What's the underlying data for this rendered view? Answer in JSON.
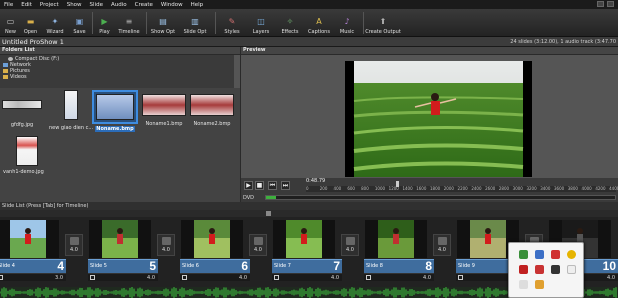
{
  "menu": [
    "File",
    "Edit",
    "Project",
    "Show",
    "Slide",
    "Audio",
    "Create",
    "Window",
    "Help"
  ],
  "toolbar": [
    {
      "label": "New",
      "icon": "new-icon",
      "color": "#c8c8c8"
    },
    {
      "label": "Open",
      "icon": "open-folder-icon",
      "color": "#d9b04a"
    },
    {
      "label": "Wizard",
      "icon": "wizard-icon",
      "color": "#8fb4e0"
    },
    {
      "label": "Save",
      "icon": "save-icon",
      "color": "#7aa0d0"
    },
    {
      "label": "Play",
      "icon": "play-icon",
      "color": "#4caf50"
    },
    {
      "label": "Timeline",
      "icon": "timeline-icon",
      "color": "#b0b0b0"
    },
    {
      "label": "Show Opt",
      "icon": "show-options-icon",
      "color": "#9cc3e8"
    },
    {
      "label": "Slide Opt",
      "icon": "slide-options-icon",
      "color": "#9cc3e8"
    },
    {
      "label": "Styles",
      "icon": "styles-icon",
      "color": "#d07070"
    },
    {
      "label": "Layers",
      "icon": "layers-icon",
      "color": "#7ab0e0"
    },
    {
      "label": "Effects",
      "icon": "effects-icon",
      "color": "#70b070"
    },
    {
      "label": "Captions",
      "icon": "captions-icon",
      "color": "#e0c050"
    },
    {
      "label": "Music",
      "icon": "music-icon",
      "color": "#b080d0"
    },
    {
      "label": "Create Output",
      "icon": "create-output-icon",
      "color": "#b0b0b0"
    }
  ],
  "project": {
    "title": "Untitled ProShow 1",
    "stats": "24 slides (3:12.00), 1 audio track (3:47.70"
  },
  "folders": {
    "header": "Folders List",
    "items": [
      "Compact Disc (F:)",
      "Network",
      "Pictures",
      "Videos"
    ]
  },
  "files": [
    {
      "name": "gfdfg.jpg"
    },
    {
      "name": "new giao dien c..."
    },
    {
      "name": "Noname.bmp",
      "selected": true
    },
    {
      "name": "Noname1.bmp"
    },
    {
      "name": "Noname2.bmp"
    },
    {
      "name": "vanh1-demo.jpg"
    }
  ],
  "preview": {
    "header": "Preview",
    "timecode": "0:48.79",
    "ruler": [
      "0",
      "100",
      "200",
      "300",
      "400",
      "500",
      "600",
      "700",
      "800",
      "900",
      "1000",
      "1100",
      "1200",
      "1300",
      "1400",
      "1500",
      "1600",
      "1700",
      "1800",
      "1900",
      "2000",
      "2100",
      "2200",
      "2300",
      "2400",
      "2500",
      "2600",
      "2700",
      "2800",
      "2900",
      "3000",
      "3100",
      "3200",
      "3300",
      "3400",
      "3500",
      "3600",
      "3700",
      "3800",
      "3900",
      "4000",
      "4100",
      "4200",
      "4300",
      "4400"
    ],
    "dvd_label": "DVD",
    "dvd_fill": 0.03
  },
  "slidelist": {
    "header": "Slide List (Press [Tab] for Timeline)",
    "slides": [
      {
        "name": "Slide 4",
        "num": "4",
        "dur": "3.0",
        "trans": "4.0"
      },
      {
        "name": "Slide 5",
        "num": "5",
        "dur": "4.0",
        "trans": "4.0"
      },
      {
        "name": "Slide 6",
        "num": "6",
        "dur": "4.0",
        "trans": "4.0"
      },
      {
        "name": "Slide 7",
        "num": "7",
        "dur": "4.0",
        "trans": "4.0"
      },
      {
        "name": "Slide 8",
        "num": "8",
        "dur": "4.0",
        "trans": "4.0"
      },
      {
        "name": "Slide 9",
        "num": "9",
        "dur": "4.0",
        "trans": "4.0"
      },
      {
        "name": "",
        "num": "10",
        "dur": "4.0",
        "trans": ""
      }
    ]
  },
  "colors": {
    "accent": "#3f6d9e",
    "selection": "#2b6cb8",
    "audio_wave": "#3fc83f"
  }
}
